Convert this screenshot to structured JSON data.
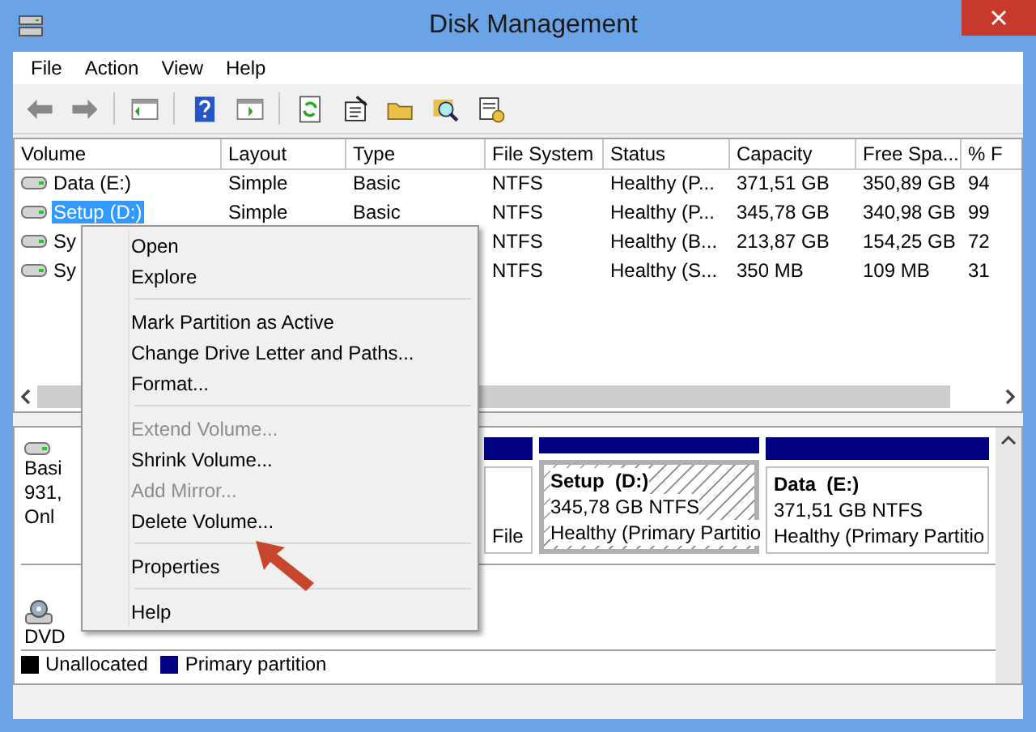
{
  "window": {
    "title": "Disk Management"
  },
  "menu_bar": [
    "File",
    "Action",
    "View",
    "Help"
  ],
  "table": {
    "columns": [
      "Volume",
      "Layout",
      "Type",
      "File System",
      "Status",
      "Capacity",
      "Free Spa...",
      "% F"
    ],
    "rows": [
      {
        "volume": "Data (E:)",
        "layout": "Simple",
        "type": "Basic",
        "file_system": "NTFS",
        "status": "Healthy (P...",
        "capacity": "371,51 GB",
        "free_space": "350,89 GB",
        "percent_free": "94",
        "selected": false
      },
      {
        "volume": "Setup (D:)",
        "layout": "Simple",
        "type": "Basic",
        "file_system": "NTFS",
        "status": "Healthy (P...",
        "capacity": "345,78 GB",
        "free_space": "340,98 GB",
        "percent_free": "99",
        "selected": true
      },
      {
        "volume": "Sy",
        "file_system": "NTFS",
        "status": "Healthy (B...",
        "capacity": "213,87 GB",
        "free_space": "154,25 GB",
        "percent_free": "72",
        "selected": false
      },
      {
        "volume": "Sy",
        "file_system": "NTFS",
        "status": "Healthy (S...",
        "capacity": "350 MB",
        "free_space": "109 MB",
        "percent_free": "31",
        "selected": false
      }
    ]
  },
  "disk_map": {
    "disks": [
      {
        "kind": "disk",
        "label_lines": [
          "Basi",
          "931,",
          "Onl"
        ],
        "partitions": [
          {
            "status": "File",
            "selected": false
          },
          {
            "name": "Setup  (D:)",
            "size": "345,78 GB NTFS",
            "status": "Healthy (Primary Partitio",
            "selected": true
          },
          {
            "name": "Data  (E:)",
            "size": "371,51 GB NTFS",
            "status": "Healthy (Primary Partitio",
            "selected": false
          }
        ]
      },
      {
        "kind": "cdrom",
        "label_lines": [
          "DVD"
        ]
      }
    ],
    "legend": [
      {
        "label": "Unallocated",
        "color": "#000000"
      },
      {
        "label": "Primary partition",
        "color": "#000080"
      }
    ]
  },
  "context_menu": {
    "items": [
      {
        "kind": "item",
        "label": "Open",
        "disabled": false
      },
      {
        "kind": "item",
        "label": "Explore",
        "disabled": false
      },
      {
        "kind": "separator"
      },
      {
        "kind": "item",
        "label": "Mark Partition as Active",
        "disabled": false
      },
      {
        "kind": "item",
        "label": "Change Drive Letter and Paths...",
        "disabled": false
      },
      {
        "kind": "item",
        "label": "Format...",
        "disabled": false
      },
      {
        "kind": "separator"
      },
      {
        "kind": "item",
        "label": "Extend Volume...",
        "disabled": true
      },
      {
        "kind": "item",
        "label": "Shrink Volume...",
        "disabled": false
      },
      {
        "kind": "item",
        "label": "Add Mirror...",
        "disabled": true
      },
      {
        "kind": "item",
        "label": "Delete Volume...",
        "disabled": false
      },
      {
        "kind": "separator"
      },
      {
        "kind": "item",
        "label": "Properties",
        "disabled": false
      },
      {
        "kind": "separator"
      },
      {
        "kind": "item",
        "label": "Help",
        "disabled": false
      }
    ]
  }
}
